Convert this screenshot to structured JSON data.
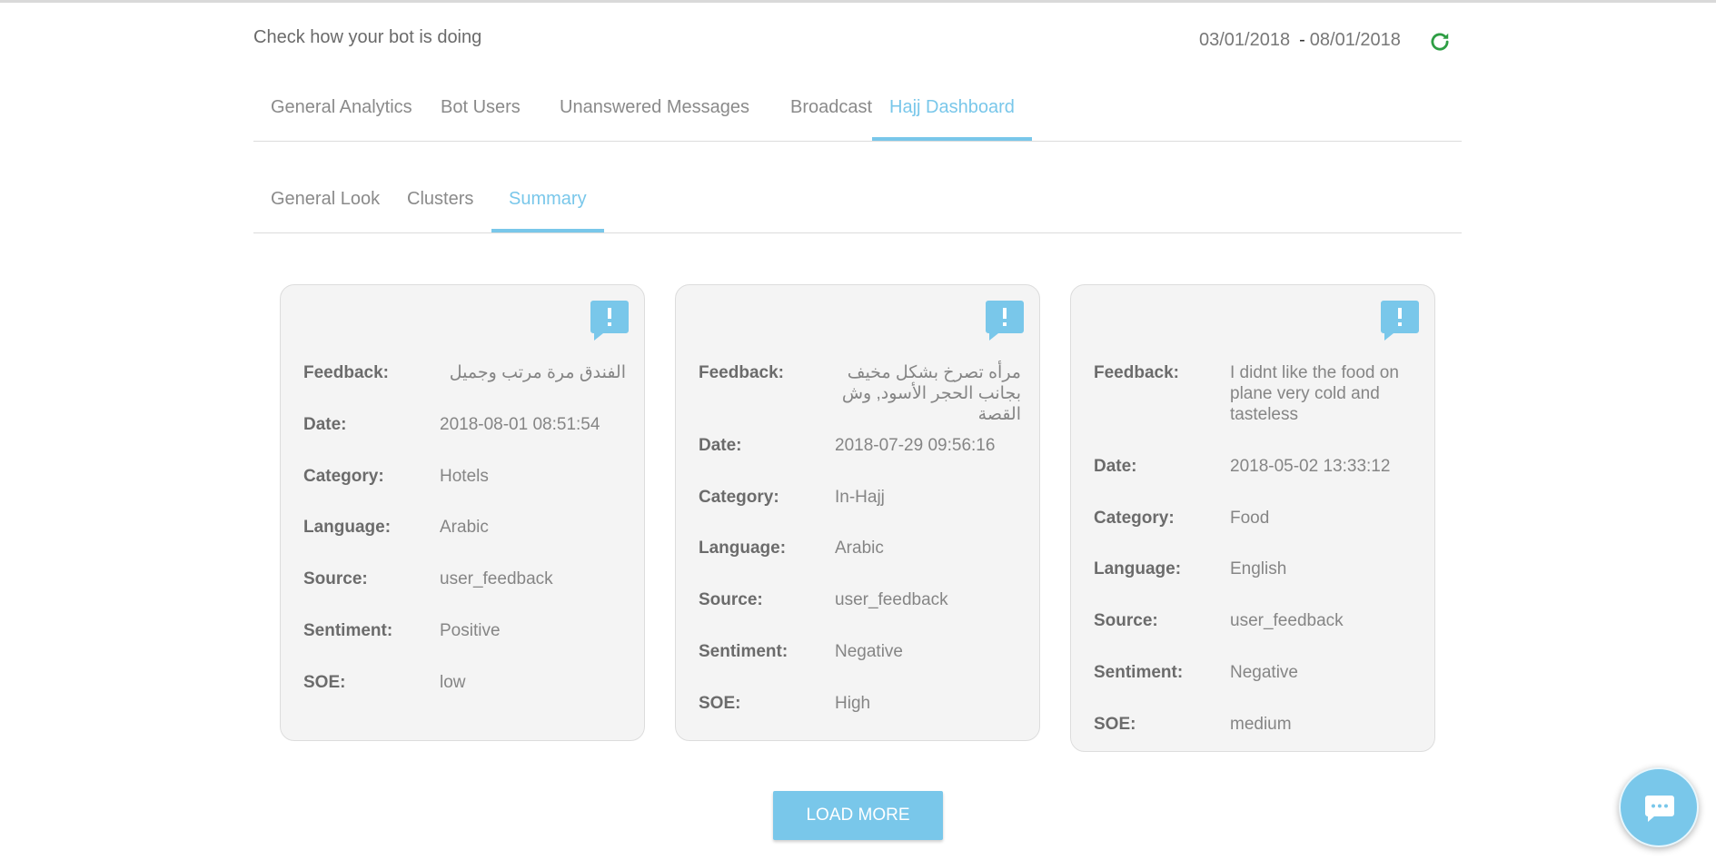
{
  "header": {
    "subtitle": "Check how your bot is doing",
    "date_from": "03/01/2018",
    "date_separator": "-",
    "date_to": "08/01/2018",
    "refresh_icon": "refresh-icon"
  },
  "main_tabs": [
    {
      "label": "General Analytics",
      "active": false
    },
    {
      "label": "Bot Users",
      "active": false
    },
    {
      "label": "Unanswered Messages",
      "active": false
    },
    {
      "label": "Broadcast",
      "active": false
    },
    {
      "label": "Hajj Dashboard",
      "active": true
    }
  ],
  "sub_tabs": [
    {
      "label": "General Look",
      "active": false
    },
    {
      "label": "Clusters",
      "active": false
    },
    {
      "label": "Summary",
      "active": true
    }
  ],
  "labels": {
    "feedback": "Feedback:",
    "date": "Date:",
    "category": "Category:",
    "language": "Language:",
    "source": "Source:",
    "sentiment": "Sentiment:",
    "soe": "SOE:"
  },
  "cards": [
    {
      "feedback": "الفندق مرة مرتب وجميل",
      "date": "2018-08-01 08:51:54",
      "category": "Hotels",
      "language": "Arabic",
      "source": "user_feedback",
      "sentiment": "Positive",
      "soe": "low"
    },
    {
      "feedback": "مرأه تصرخ بشكل مخيف بجانب الحجر الأسود, وش القصة",
      "date": "2018-07-29 09:56:16",
      "category": "In-Hajj",
      "language": "Arabic",
      "source": "user_feedback",
      "sentiment": "Negative",
      "soe": "High"
    },
    {
      "feedback": "I didnt like the food on plane very cold and tasteless",
      "date": "2018-05-02 13:33:12",
      "category": "Food",
      "language": "English",
      "source": "user_feedback",
      "sentiment": "Negative",
      "soe": "medium"
    }
  ],
  "load_more_label": "LOAD MORE",
  "colors": {
    "accent": "#79c7ea",
    "refresh": "#2e9e44",
    "card_bg": "#f4f4f4"
  }
}
